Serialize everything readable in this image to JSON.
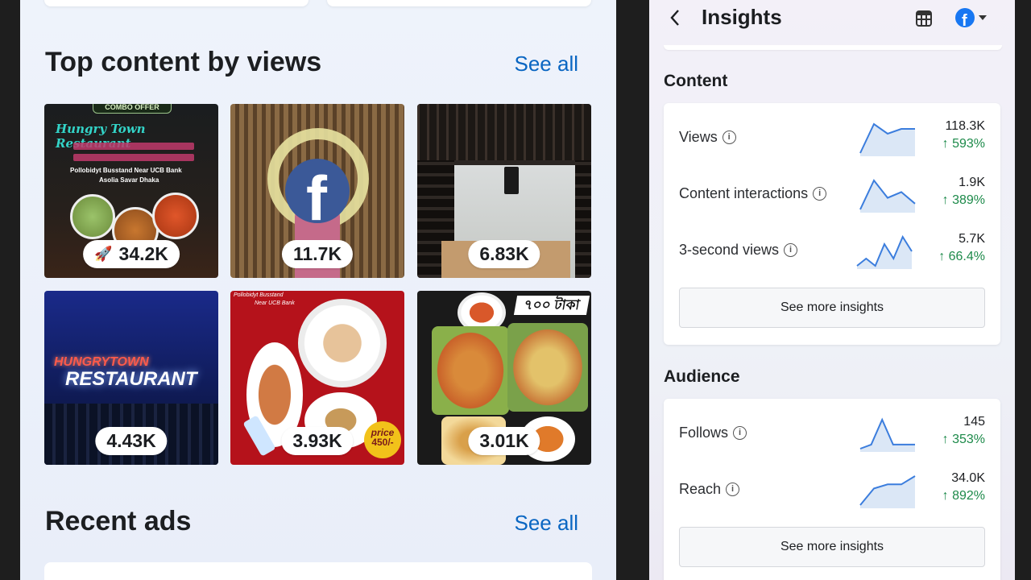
{
  "left": {
    "top_content": {
      "title": "Top content by views",
      "see_all": "See all",
      "tiles": [
        {
          "views": "34.2K",
          "caption_top": "COMBO OFFER",
          "caption_name": "Hungry Town Restaurant",
          "caption_line1": "Pollobidyt Busstand Near UCB Bank",
          "caption_line2": "Asolia Savar Dhaka"
        },
        {
          "views": "11.7K"
        },
        {
          "views": "6.83K"
        },
        {
          "views": "4.43K",
          "sign_top": "HUNGRYTOWN",
          "sign_bottom": "RESTAURANT"
        },
        {
          "views": "3.93K",
          "caption_top": "Pollobidyt Busstand",
          "caption_line2": "Near UCB Bank",
          "price_word": "price",
          "price_value": "450/-"
        },
        {
          "views": "3.01K",
          "price_tag": "৭০০ টাকা"
        }
      ]
    },
    "recent_ads": {
      "title": "Recent ads",
      "see_all": "See all"
    }
  },
  "right": {
    "header": {
      "title": "Insights"
    },
    "content": {
      "title": "Content",
      "metrics": [
        {
          "label": "Views",
          "value": "118.3K",
          "change": "↑ 593%",
          "trend": [
            2,
            8,
            6,
            7,
            7
          ]
        },
        {
          "label": "Content interactions",
          "value": "1.9K",
          "change": "↑ 389%",
          "trend": [
            2,
            7,
            4,
            5,
            3
          ]
        },
        {
          "label": "3-second views",
          "value": "5.7K",
          "change": "↑ 66.4%",
          "trend": [
            3,
            4,
            3,
            6,
            4,
            7,
            5
          ]
        }
      ],
      "more": "See more insights"
    },
    "audience": {
      "title": "Audience",
      "metrics": [
        {
          "label": "Follows",
          "value": "145",
          "change": "↑ 353%",
          "trend": [
            2,
            3,
            9,
            3,
            3,
            3
          ]
        },
        {
          "label": "Reach",
          "value": "34.0K",
          "change": "↑ 892%",
          "trend": [
            1,
            5,
            6,
            6,
            8
          ]
        }
      ],
      "more": "See more insights"
    }
  },
  "colors": {
    "accent": "#0a66c2",
    "positive": "#1d8a4a",
    "facebook": "#1877f2"
  }
}
